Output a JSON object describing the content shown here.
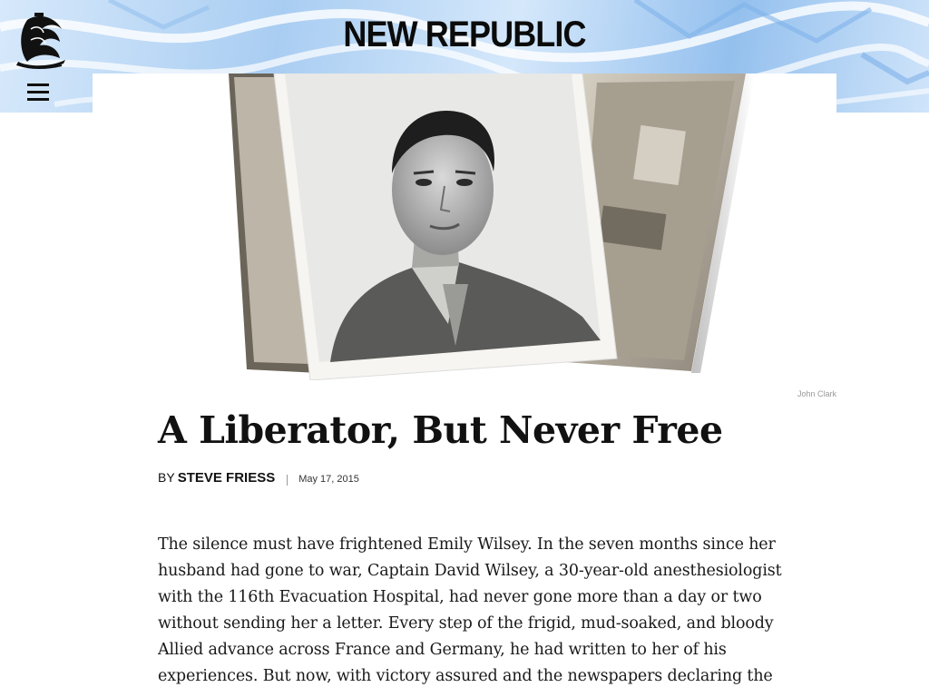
{
  "header": {
    "brand": "NEW REPUBLIC",
    "menu_icon": "hamburger-menu-icon",
    "logo_icon": "ship-logo-icon",
    "band_colors": [
      "#d7e9fb",
      "#a9cdf2",
      "#94c0ee"
    ]
  },
  "hero": {
    "photo_credit": "John Clark"
  },
  "article": {
    "headline": "A Liberator, But Never Free",
    "byline_prefix": "BY",
    "author": "STEVE FRIESS",
    "date": "May 17, 2015",
    "body_lines": [
      "The silence must have frightened Emily Wilsey. In the seven months since her",
      "husband had gone to war, Captain David Wilsey, a 30-year-old anesthesiologist",
      "with the 116th Evacuation Hospital, had never gone more than a day or two",
      "without sending her a letter. Every step of the frigid, mud-soaked, and bloody",
      "Allied advance across France and Germany, he had written to her of his",
      "experiences. But now, with victory assured and the newspapers declaring the"
    ]
  }
}
